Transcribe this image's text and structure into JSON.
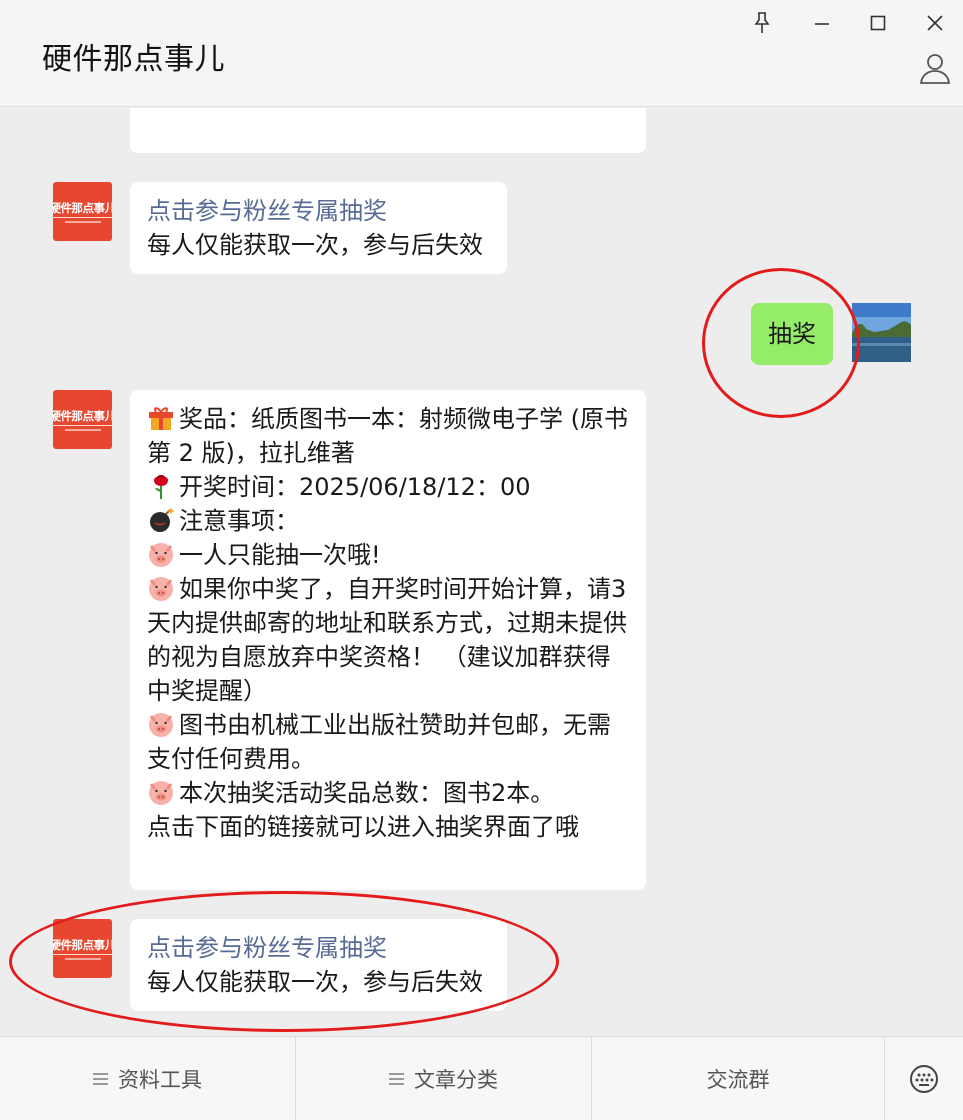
{
  "window": {
    "title": "硬件那点事儿",
    "controls": [
      "pin-icon",
      "minimize-icon",
      "maximize-icon",
      "close-icon"
    ],
    "profile_icon": "person-icon"
  },
  "brand_avatar": {
    "text": "硬件那点事儿"
  },
  "messages": {
    "first_link": {
      "title": "点击参与粉丝专属抽奖",
      "desc": "每人仅能获取一次，参与后失效"
    },
    "user_reply": {
      "text": "抽奖"
    },
    "announcement": {
      "prize_label": "奖品：纸质图书一本：射频微电子学 (原书第 2 版)，拉扎维著",
      "draw_time": "开奖时间：2025/06/18/12：00",
      "notes_title": "注意事项：",
      "rule1": "一人只能抽一次哦!",
      "rule2": "如果你中奖了，自开奖时间开始计算，请3天内提供邮寄的地址和联系方式，过期未提供的视为自愿放弃中奖资格！ （建议加群获得中奖提醒）",
      "rule3": "图书由机械工业出版社赞助并包邮，无需支付任何费用。",
      "rule4": "本次抽奖活动奖品总数：图书2本。",
      "footer": "点击下面的链接就可以进入抽奖界面了哦"
    },
    "second_link": {
      "title": "点击参与粉丝专属抽奖",
      "desc": "每人仅能获取一次，参与后失效"
    }
  },
  "emoji": [
    "gift-icon",
    "rose-icon",
    "bomb-icon",
    "pig-icon"
  ],
  "toolbar": {
    "items": [
      {
        "label": "资料工具",
        "icon": "menu-icon"
      },
      {
        "label": "文章分类",
        "icon": "menu-icon"
      },
      {
        "label": "交流群"
      }
    ],
    "keyboard_icon": "keyboard-icon"
  },
  "colors": {
    "link": "#576b95",
    "self_bubble": "#95ec69",
    "brand": "#e8472f",
    "annotation": "#e31b1b"
  }
}
